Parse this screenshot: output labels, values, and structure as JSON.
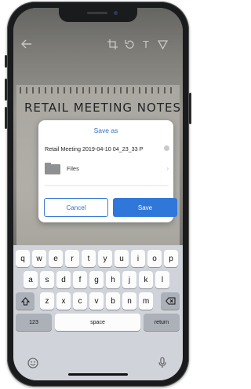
{
  "toolbar": {
    "back_icon": "arrow-left-icon",
    "crop_icon": "crop-icon",
    "rotate_icon": "rotate-icon",
    "text_icon": "T",
    "draw_icon": "pen-icon"
  },
  "background": {
    "notes_title": "RETAIL MEETING NOTES"
  },
  "dialog": {
    "title": "Save as",
    "filename": "Retail Meeting 2019-04-10 04_23_33 P",
    "folder_label": "Files",
    "cancel_label": "Cancel",
    "save_label": "Save"
  },
  "keyboard": {
    "row1": [
      "q",
      "w",
      "e",
      "r",
      "t",
      "y",
      "u",
      "i",
      "o",
      "p"
    ],
    "row2": [
      "a",
      "s",
      "d",
      "f",
      "g",
      "h",
      "j",
      "k",
      "l"
    ],
    "row3": [
      "z",
      "x",
      "c",
      "v",
      "b",
      "n",
      "m"
    ],
    "numbers_label": "123",
    "space_label": "space",
    "return_label": "return"
  },
  "colors": {
    "accent": "#2f77d9",
    "keyboard_bg": "#d0d3d9"
  }
}
